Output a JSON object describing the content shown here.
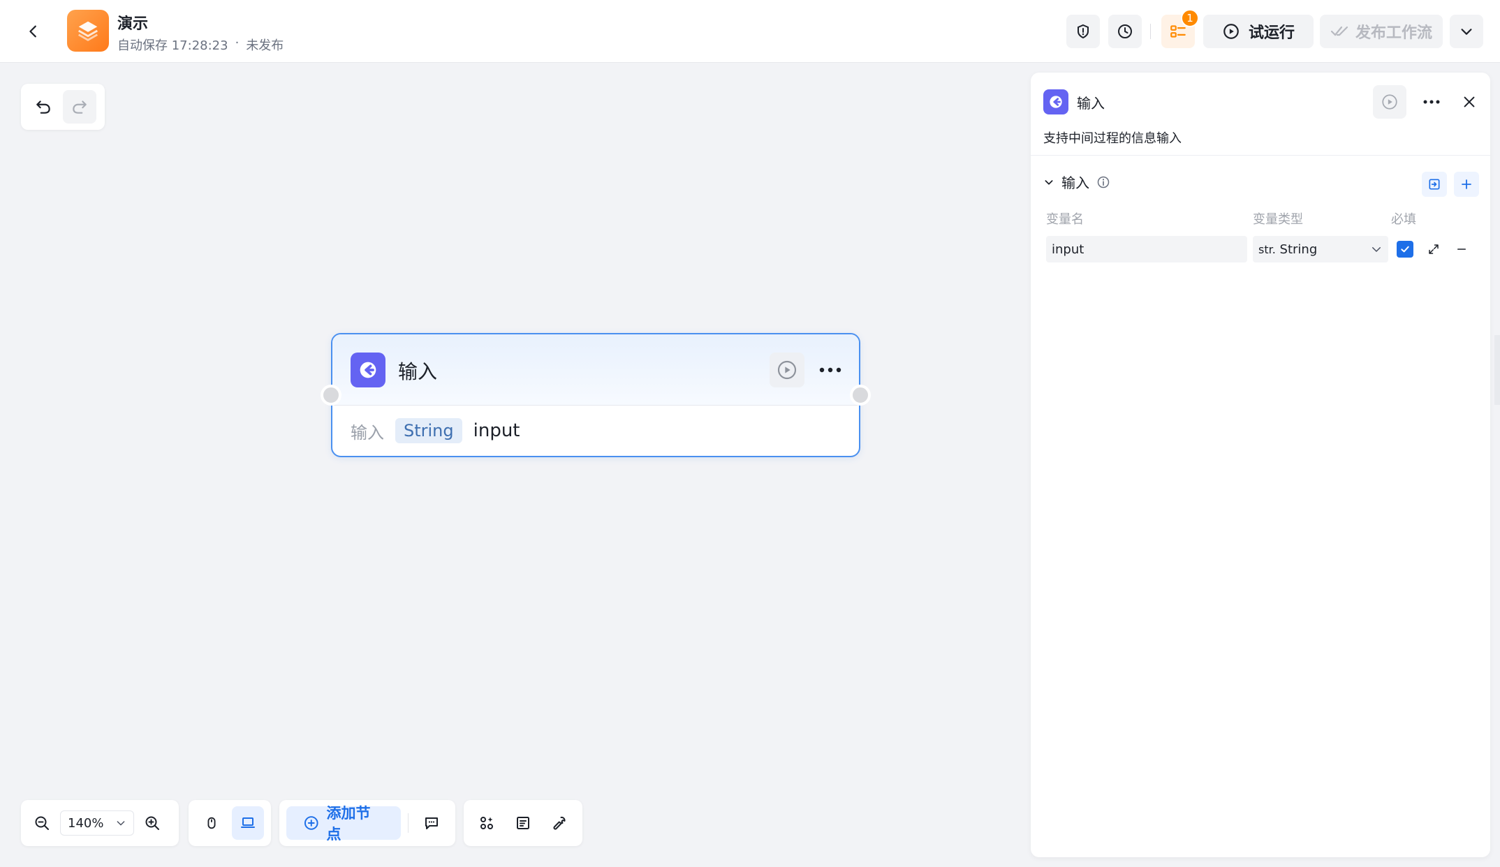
{
  "header": {
    "app_title": "演示",
    "autosave_text": "自动保存 17:28:23",
    "dot": "·",
    "publish_status": "未发布",
    "badge_count": "1",
    "run_label": "试运行",
    "publish_label": "发布工作流"
  },
  "node": {
    "title": "输入",
    "body_label": "输入",
    "var_type": "String",
    "var_name": "input"
  },
  "panel": {
    "title": "输入",
    "description": "支持中间过程的信息输入",
    "section_title": "输入",
    "columns": {
      "name": "变量名",
      "type": "变量类型",
      "required": "必填"
    },
    "variable": {
      "name": "input",
      "type_prefix": "str.",
      "type_label": "String",
      "required": true
    }
  },
  "toolbar": {
    "zoom": "140%",
    "add_node_label": "添加节点"
  },
  "colors": {
    "accent": "#1e6fe8",
    "node_border": "#4a90f0",
    "node_icon": "#6463f2",
    "badge": "#ff8a00",
    "logo": "#ff8a2a"
  }
}
